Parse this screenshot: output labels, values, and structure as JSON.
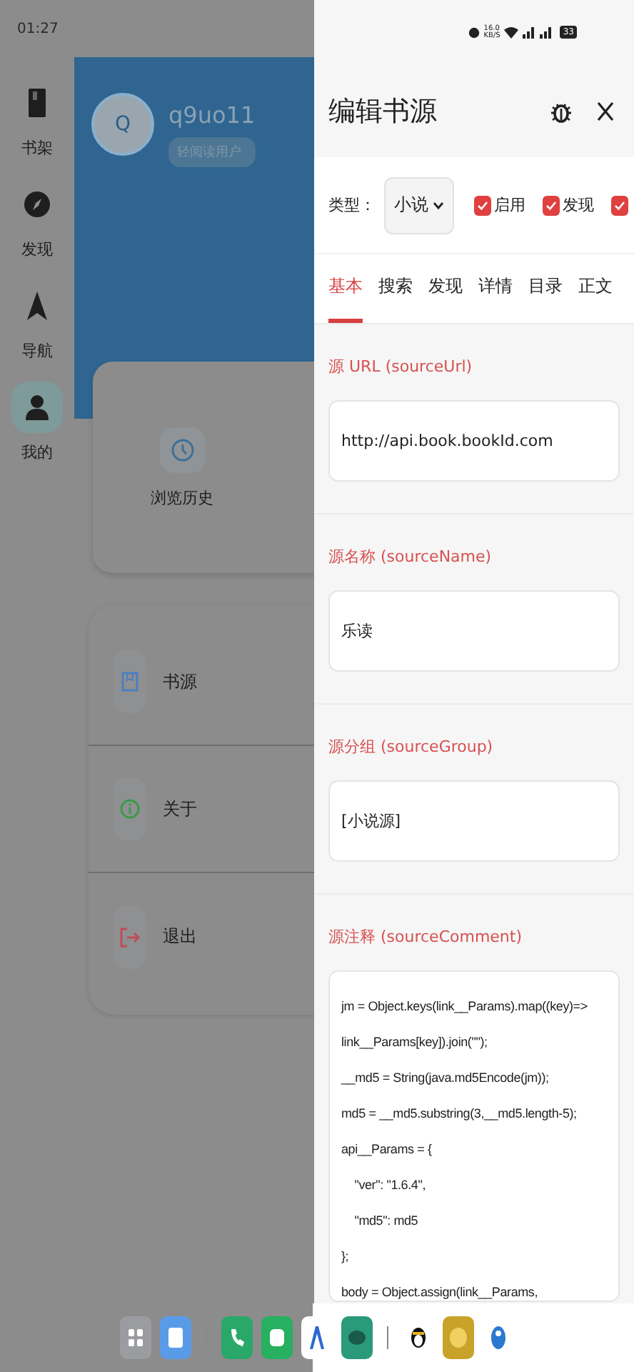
{
  "status_bar": {
    "time": "01:27",
    "speed": "16.0",
    "speed_unit": "KB/S",
    "battery": "33"
  },
  "background_app": {
    "nav": [
      {
        "label": "书架",
        "selected": false
      },
      {
        "label": "发现",
        "selected": false
      },
      {
        "label": "导航",
        "selected": false
      },
      {
        "label": "我的",
        "selected": true
      }
    ],
    "profile": {
      "avatar": "Q",
      "name": "q9uo11",
      "badge": "轻阅读用户"
    },
    "shortcut": {
      "label": "浏览历史"
    },
    "menu": [
      {
        "label": "书源",
        "color": "#4a7fc0"
      },
      {
        "label": "关于",
        "color": "#3a9a4a"
      },
      {
        "label": "退出",
        "color": "#c04a5a"
      }
    ]
  },
  "editor": {
    "title": "编辑书源",
    "type_label": "类型：",
    "type_value": "小说",
    "options": [
      {
        "label": "启用",
        "checked": true
      },
      {
        "label": "发现",
        "checked": true
      },
      {
        "checked": true
      }
    ],
    "tabs": [
      {
        "label": "基本",
        "selected": true
      },
      {
        "label": "搜索",
        "selected": false
      },
      {
        "label": "发现",
        "selected": false
      },
      {
        "label": "详情",
        "selected": false
      },
      {
        "label": "目录",
        "selected": false
      },
      {
        "label": "正文",
        "selected": false
      }
    ],
    "fields": [
      {
        "label": "源 URL (sourceUrl)",
        "value": "http://api.book.bookId.com"
      },
      {
        "label": "源名称 (sourceName)",
        "value": "乐读"
      },
      {
        "label": "源分组 (sourceGroup)",
        "value": "[小说源]"
      }
    ],
    "comment": {
      "label": "源注释 (sourceComment)",
      "lines": [
        "jm = Object.keys(link__Params).map((key)=>",
        "link__Params[key]).join(\"\");",
        "__md5 = String(java.md5Encode(jm));",
        "md5 = __md5.substring(3,__md5.length-5);",
        "api__Params = {",
        "    \"ver\": \"1.6.4\",",
        "    \"md5\": md5",
        "};",
        "body = Object.assign(link__Params,"
      ]
    }
  }
}
